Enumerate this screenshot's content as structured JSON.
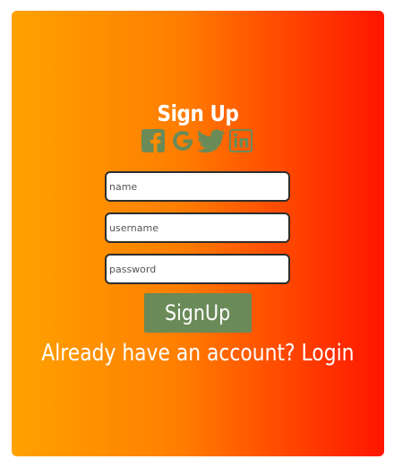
{
  "form": {
    "title": "Sign Up",
    "name_placeholder": "name",
    "username_placeholder": "username",
    "password_placeholder": "password",
    "submit_label": "SignUp",
    "login_link": "Already have an account? Login"
  },
  "social": {
    "icons": [
      "facebook-icon",
      "google-icon",
      "twitter-icon",
      "linkedin-icon"
    ],
    "icon_color": "#6a8a58"
  },
  "colors": {
    "gradient_start": "#ffa200",
    "gradient_end": "#ff1500",
    "button": "#6a8a58",
    "text": "#ffffff"
  }
}
